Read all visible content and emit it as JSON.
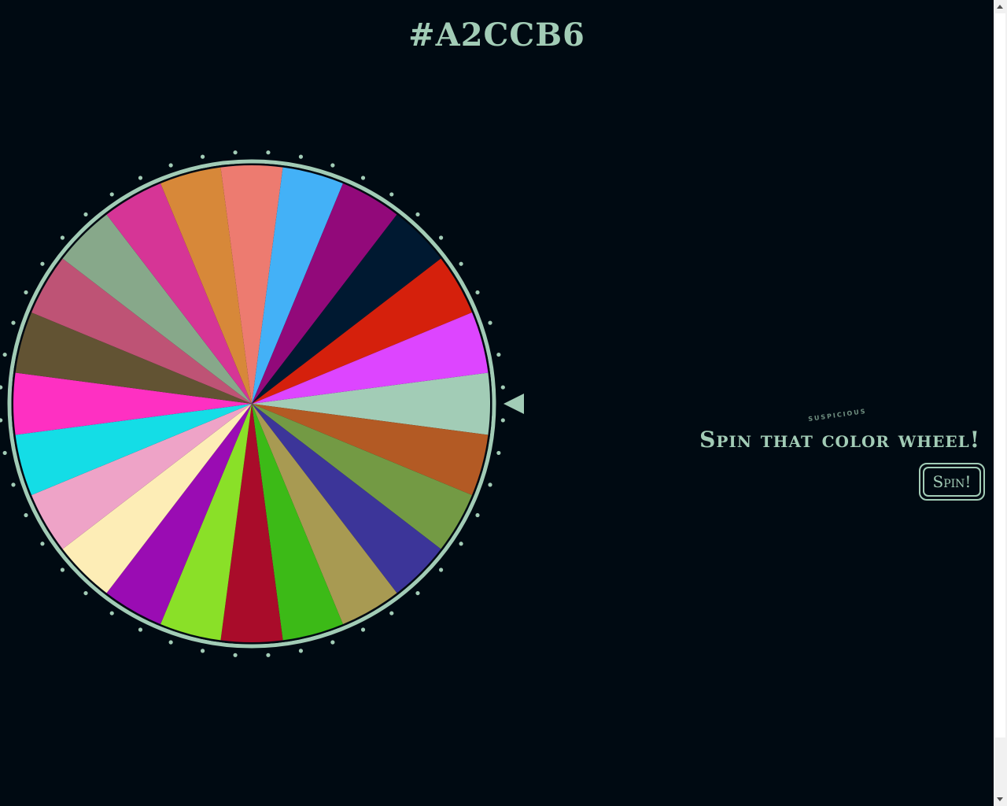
{
  "header": {
    "title": "#A2CCB6"
  },
  "accent_color": "#a2ccb6",
  "background_color": "#000a12",
  "wheel": {
    "segment_colors": [
      "#a2ccb6",
      "#b35a24",
      "#739a44",
      "#3c3599",
      "#a89a52",
      "#3cba17",
      "#a90c2a",
      "#8ae028",
      "#9a0cb3",
      "#fdedb6",
      "#eea3c7",
      "#14dde6",
      "#fe30c2",
      "#625333",
      "#be5375",
      "#87a88a",
      "#d63596",
      "#d78839",
      "#ed7b70",
      "#43b1f7",
      "#92097a",
      "#001931",
      "#d5200c",
      "#dd45ff"
    ],
    "selected_color": "#a2ccb6"
  },
  "panel": {
    "kicker": "suspicious",
    "tagline": "Spin that color wheel!",
    "spin_label": "Spin!"
  }
}
